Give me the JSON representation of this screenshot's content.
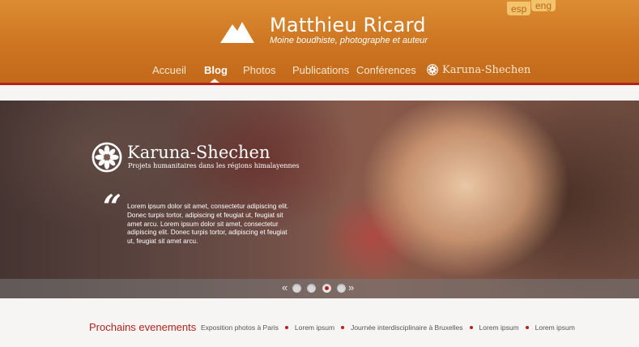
{
  "header": {
    "title": "Matthieu Ricard",
    "subtitle": "Moine boudhiste, photographe et auteur",
    "languages": [
      "esp",
      "eng"
    ],
    "nav": [
      {
        "label": "Accueil",
        "active": false
      },
      {
        "label": "Blog",
        "active": true
      },
      {
        "label": "Photos",
        "active": false
      },
      {
        "label": "Publications",
        "active": false
      },
      {
        "label": "Conférences",
        "active": false
      },
      {
        "label": "Karuna-Shechen",
        "active": false
      }
    ],
    "accent_color": "#cc7421",
    "rule_color": "#b5221c"
  },
  "slider": {
    "brand": "Karuna-Shechen",
    "tagline": "Projets humanitaires dans les régions himalayennes",
    "quote_mark": "“",
    "quote": "Lorem ipsum dolor sit amet, consectetur adipiscing elit. Donec turpis tortor, adipiscing et feugiat ut, feugiat sit amet arcu. Lorem ipsum dolor sit amet, consectetur adipiscing elit. Donec turpis tortor, adipiscing et feugiat ut, feugiat sit amet arcu.",
    "prev_arrow": "«",
    "next_arrow": "»",
    "slide_count": 4,
    "active_slide": 3
  },
  "events": {
    "title": "Prochains evenements",
    "items": [
      "Exposition photos à Paris",
      "Lorem ipsum",
      "Journée interdisciplinaire à Bruxelles",
      "Lorem ipsum",
      "Lorem ipsum"
    ]
  }
}
